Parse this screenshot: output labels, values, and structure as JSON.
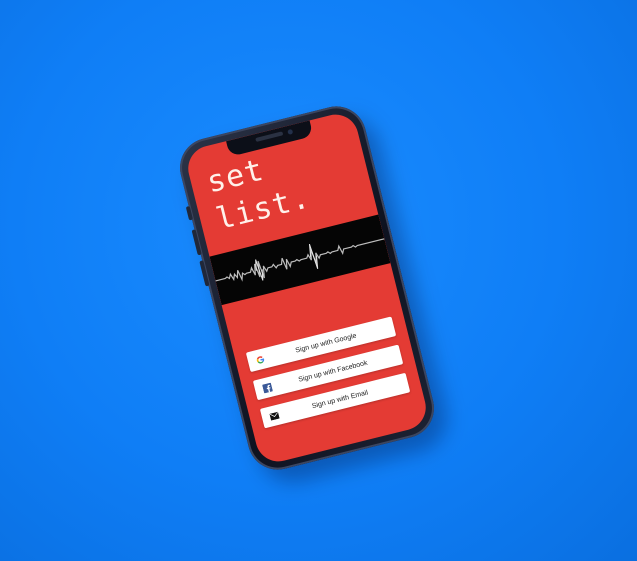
{
  "app": {
    "title_line1": "set",
    "title_line2": "list."
  },
  "signup": {
    "google_label": "Sign up with Google",
    "facebook_label": "Sign up with Facebook",
    "email_label": "Sign up with Email"
  },
  "icons": {
    "google": "google-icon",
    "facebook": "facebook-icon",
    "email": "envelope-icon"
  },
  "colors": {
    "background": "#0f7ef6",
    "screen": "#e43b34",
    "title_text": "#fff1ea",
    "wave_band": "#050505",
    "facebook_blue": "#3b5998"
  }
}
